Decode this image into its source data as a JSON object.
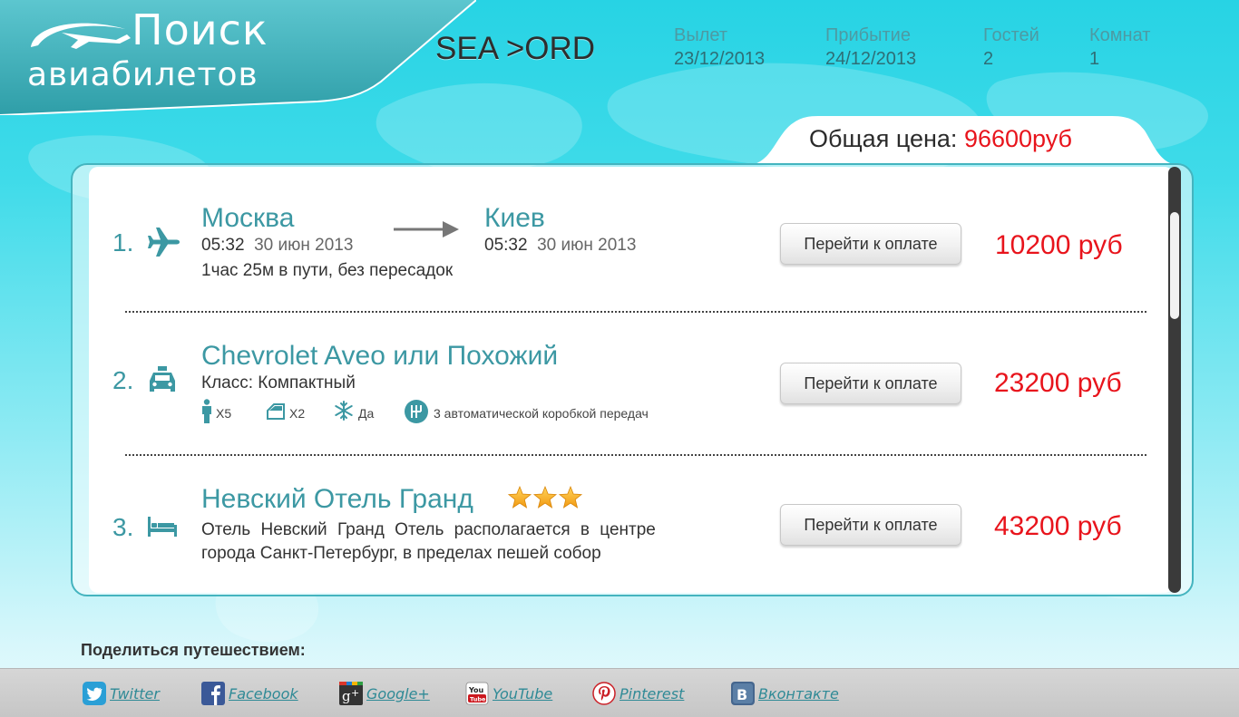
{
  "logo": {
    "line1": "Поиск",
    "line2": "авиабилетов"
  },
  "route": "SEA >ORD",
  "meta": [
    {
      "label": "Вылет",
      "value": "23/12/2013"
    },
    {
      "label": "Прибытие",
      "value": "24/12/2013"
    },
    {
      "label": "Гостей",
      "value": "2"
    },
    {
      "label": "Комнат",
      "value": "1"
    }
  ],
  "total": {
    "label": "Общая цена:",
    "value": "96600руб"
  },
  "items": [
    {
      "num": "1.",
      "icon": "airplane-icon",
      "from_city": "Москва",
      "from_time": "05:32",
      "from_date": "30 июн 2013",
      "to_city": "Киев",
      "to_time": "05:32",
      "to_date": "30 июн 2013",
      "duration": "1час 25м в пути, без пересадок",
      "button": "Перейти к оплате",
      "price": "10200 руб"
    },
    {
      "num": "2.",
      "icon": "taxi-icon",
      "title": "Chevrolet Aveo или Похожий",
      "class_line": "Класс: Компактный",
      "features": [
        {
          "icon": "person-icon",
          "text": "X5"
        },
        {
          "icon": "door-icon",
          "text": "X2"
        },
        {
          "icon": "snowflake-icon",
          "text": "Да"
        },
        {
          "icon": "gearbox-icon",
          "text": "3 автоматической коробкой передач"
        }
      ],
      "button": "Перейти к оплате",
      "price": "23200 руб"
    },
    {
      "num": "3.",
      "icon": "bed-icon",
      "title": "Невский Отель Гранд",
      "stars": 3,
      "desc_line1": "Отель Невский Гранд Отель располагается в центре",
      "desc_line2": "города Санкт-Петербург, в пределах пешей собор",
      "button": "Перейти к оплате",
      "price": "43200 руб"
    }
  ],
  "share": {
    "title": "Поделиться путешествием:",
    "links": [
      {
        "icon": "twitter-icon",
        "label": "Twitter"
      },
      {
        "icon": "facebook-icon",
        "label": "Facebook"
      },
      {
        "icon": "google-plus-icon",
        "label": "Google+"
      },
      {
        "icon": "youtube-icon",
        "label": "YouTube"
      },
      {
        "icon": "pinterest-icon",
        "label": "Pinterest"
      },
      {
        "icon": "vkontakte-icon",
        "label": "Вконтакте"
      }
    ]
  },
  "colors": {
    "accent": "#3c98a3",
    "price": "#e8141c",
    "header_bg": "#27d3e4"
  }
}
